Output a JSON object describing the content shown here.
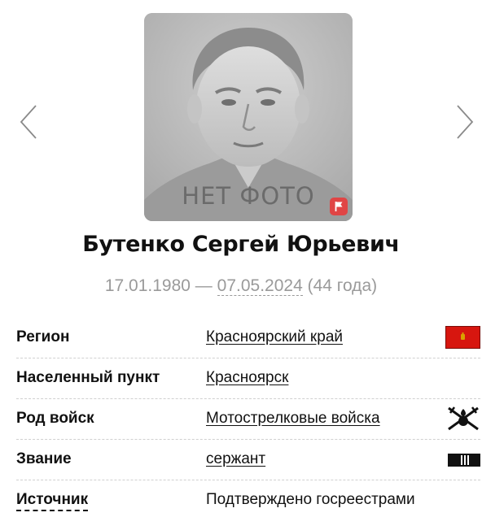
{
  "navigation": {
    "prev_icon": "chevron-left-icon",
    "next_icon": "chevron-right-icon"
  },
  "photo": {
    "placeholder_text": "НЕТ ФОТО",
    "flag_icon": "flag-icon",
    "flag_color": "#e04545"
  },
  "person": {
    "name": "Бутенко Сергей Юрьевич",
    "birth_date": "17.01.1980",
    "separator": " — ",
    "death_date": "07.05.2024",
    "age": " (44 года)"
  },
  "info": {
    "rows": [
      {
        "label": "Регион",
        "value": "Красноярский край",
        "icon": "region-flag-icon"
      },
      {
        "label": "Населенный пункт",
        "value": "Красноярск"
      },
      {
        "label": "Род войск",
        "value": "Мотострелковые войска",
        "icon": "crossed-swords-emblem-icon"
      },
      {
        "label": "Звание",
        "value": "сержант",
        "icon": "rank-insignia-icon"
      },
      {
        "label": "Источник",
        "value": "Подтверждено госреестрами"
      }
    ]
  },
  "colors": {
    "muted_text": "#9a9a9a",
    "region_flag_red": "#d7160f",
    "region_flag_emblem": "#d9a000"
  }
}
